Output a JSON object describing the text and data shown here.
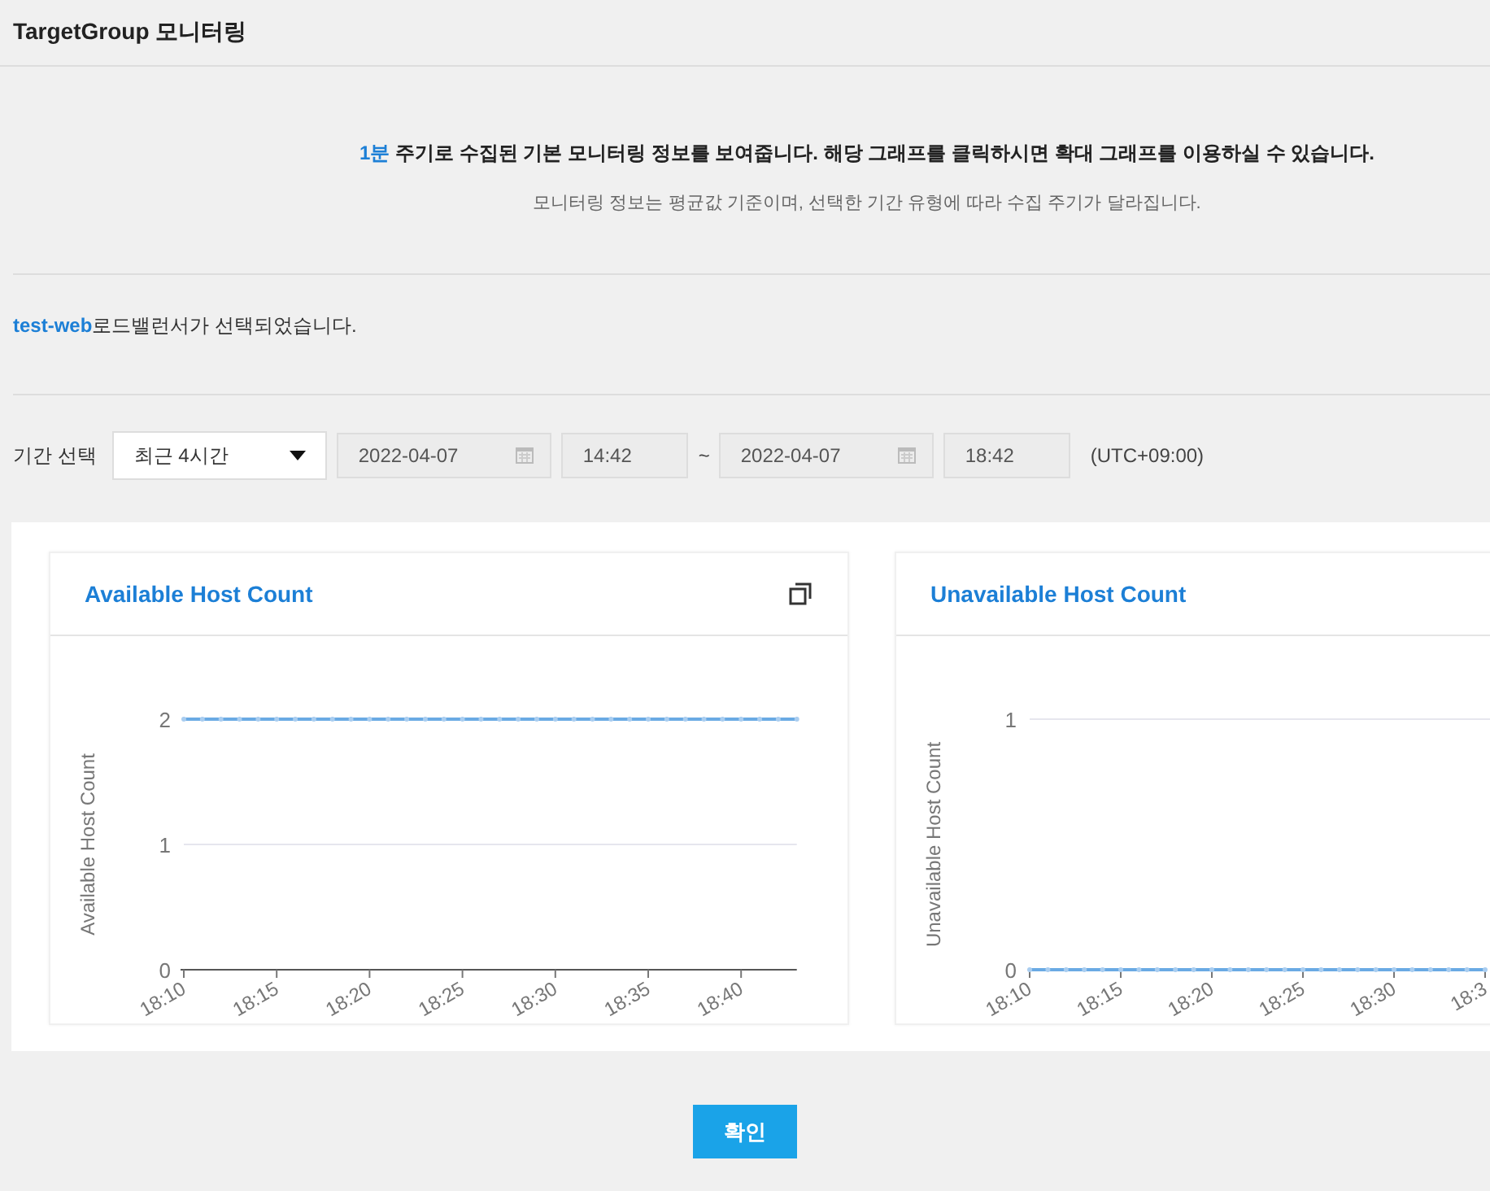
{
  "page_title": "TargetGroup 모니터링",
  "info": {
    "interval": "1분",
    "message": " 주기로 수집된 기본 모니터링 정보를 보여줍니다. 해당 그래프를 클릭하시면 확대 그래프를 이용하실 수 있습니다.",
    "note": "모니터링 정보는 평균값 기준이며, 선택한 기간 유형에 따라 수집 주기가 달라집니다."
  },
  "selection": {
    "name": "test-web",
    "message": "로드밸런서가 선택되었습니다."
  },
  "period": {
    "label": "기간 선택",
    "preset": "최근 4시간",
    "start_date": "2022-04-07",
    "start_time": "14:42",
    "separator": "~",
    "end_date": "2022-04-07",
    "end_time": "18:42",
    "timezone": "(UTC+09:00)"
  },
  "charts": [
    {
      "title": "Available Host Count",
      "expandable": true,
      "chart_data": {
        "type": "line",
        "ylabel": "Available Host Count",
        "categories": [
          "18:10",
          null,
          null,
          null,
          null,
          "18:15",
          null,
          null,
          null,
          null,
          "18:20",
          null,
          null,
          null,
          null,
          "18:25",
          null,
          null,
          null,
          null,
          "18:30",
          null,
          null,
          null,
          null,
          "18:35",
          null,
          null,
          null,
          null,
          "18:40",
          null,
          null,
          null
        ],
        "series": [
          {
            "color": "#6aaae4",
            "marker": true,
            "values": [
              2,
              2,
              2,
              2,
              2,
              2,
              2,
              2,
              2,
              2,
              2,
              2,
              2,
              2,
              2,
              2,
              2,
              2,
              2,
              2,
              2,
              2,
              2,
              2,
              2,
              2,
              2,
              2,
              2,
              2,
              2,
              2,
              2,
              2
            ]
          }
        ],
        "ylim": [
          0,
          2
        ],
        "yticks": [
          0,
          1,
          2
        ]
      }
    },
    {
      "title": "Unavailable Host Count",
      "expandable": false,
      "chart_data": {
        "type": "line",
        "ylabel": "Unavailable Host Count",
        "categories": [
          "18:10",
          null,
          null,
          null,
          null,
          "18:15",
          null,
          null,
          null,
          null,
          "18:20",
          null,
          null,
          null,
          null,
          "18:25",
          null,
          null,
          null,
          null,
          "18:30",
          null,
          null,
          null,
          null,
          "18:3"
        ],
        "series": [
          {
            "color": "#6aaae4",
            "marker": true,
            "values": [
              0,
              0,
              0,
              0,
              0,
              0,
              0,
              0,
              0,
              0,
              0,
              0,
              0,
              0,
              0,
              0,
              0,
              0,
              0,
              0,
              0,
              0,
              0,
              0,
              0,
              0
            ]
          }
        ],
        "ylim": [
          0,
          1
        ],
        "yticks": [
          0,
          1
        ]
      }
    }
  ],
  "confirm_button": "확인"
}
